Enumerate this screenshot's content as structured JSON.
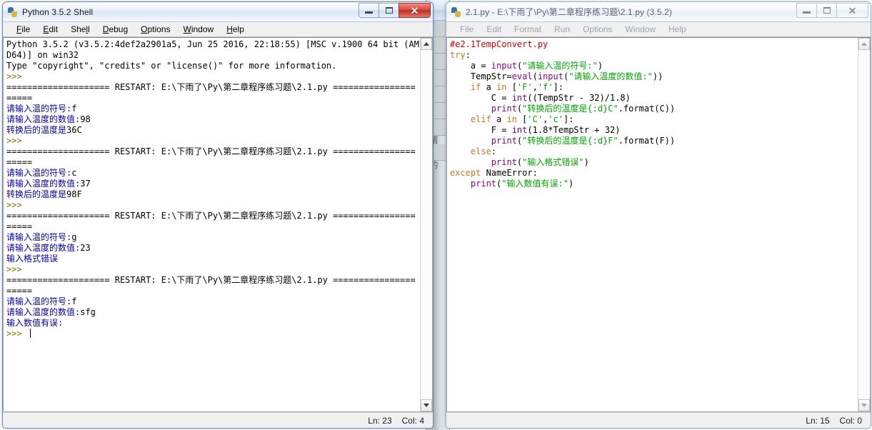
{
  "desktop": {
    "background_color": "#ffffff"
  },
  "background_window": {
    "vertical_text_1": "第",
    "vertical_text_2": "的"
  },
  "shell_window": {
    "title": "Python 3.5.2 Shell",
    "icon": "python-idle-icon",
    "active": true,
    "window_buttons": {
      "minimize": "minimize-button",
      "maximize": "maximize-button",
      "close": "✕"
    },
    "menu": [
      {
        "label": "File",
        "accel": "F"
      },
      {
        "label": "Edit",
        "accel": "E"
      },
      {
        "label": "Shell",
        "accel": "l"
      },
      {
        "label": "Debug",
        "accel": "D"
      },
      {
        "label": "Options",
        "accel": "O"
      },
      {
        "label": "Window",
        "accel": "W"
      },
      {
        "label": "Help",
        "accel": "H"
      }
    ],
    "output_lines": [
      {
        "kind": "normal",
        "text": "Python 3.5.2 (v3.5.2:4def2a2901a5, Jun 25 2016, 22:18:55) [MSC v.1900 64 bit (AMD64)] on win32"
      },
      {
        "kind": "normal",
        "text": "Type \"copyright\", \"credits\" or \"license()\" for more information."
      },
      {
        "kind": "prompt",
        "text": ">>> "
      },
      {
        "kind": "normal",
        "text": "==================== RESTART: E:\\下雨了\\Py\\第二章程序练习题\\2.1.py ====================="
      },
      {
        "kind": "output",
        "text": "请输入温的符号:",
        "input": "f"
      },
      {
        "kind": "output",
        "text": "请输入温度的数值:",
        "input": "98"
      },
      {
        "kind": "output",
        "text": "转换后的温度是",
        "input": "36C"
      },
      {
        "kind": "prompt",
        "text": ">>> "
      },
      {
        "kind": "normal",
        "text": "==================== RESTART: E:\\下雨了\\Py\\第二章程序练习题\\2.1.py ====================="
      },
      {
        "kind": "output",
        "text": "请输入温的符号:",
        "input": "c"
      },
      {
        "kind": "output",
        "text": "请输入温度的数值:",
        "input": "37"
      },
      {
        "kind": "output",
        "text": "转换后的温度是",
        "input": "98F"
      },
      {
        "kind": "prompt",
        "text": ">>> "
      },
      {
        "kind": "normal",
        "text": "==================== RESTART: E:\\下雨了\\Py\\第二章程序练习题\\2.1.py ====================="
      },
      {
        "kind": "output",
        "text": "请输入温的符号:",
        "input": "g"
      },
      {
        "kind": "output",
        "text": "请输入温度的数值:",
        "input": "23"
      },
      {
        "kind": "output",
        "text": "输入格式错误",
        "input": ""
      },
      {
        "kind": "prompt",
        "text": ">>> "
      },
      {
        "kind": "normal",
        "text": "==================== RESTART: E:\\下雨了\\Py\\第二章程序练习题\\2.1.py ====================="
      },
      {
        "kind": "output",
        "text": "请输入温的符号:",
        "input": "f"
      },
      {
        "kind": "output",
        "text": "请输入温度的数值:",
        "input": "sfg"
      },
      {
        "kind": "output",
        "text": "输入数值有误:",
        "input": ""
      },
      {
        "kind": "prompt-caret",
        "text": ">>> "
      }
    ],
    "status": {
      "line_label": "Ln: 23",
      "col_label": "Col: 4"
    }
  },
  "editor_window": {
    "title": "2.1.py - E:\\下雨了\\Py\\第二章程序练习题\\2.1.py (3.5.2)",
    "icon": "python-idle-icon",
    "active": false,
    "window_buttons": {
      "minimize": "minimize-button",
      "maximize": "maximize-button",
      "close": "✕"
    },
    "menu": [
      {
        "label": "File",
        "accel": ""
      },
      {
        "label": "Edit",
        "accel": ""
      },
      {
        "label": "Format",
        "accel": ""
      },
      {
        "label": "Run",
        "accel": ""
      },
      {
        "label": "Options",
        "accel": ""
      },
      {
        "label": "Window",
        "accel": ""
      },
      {
        "label": "Help",
        "accel": ""
      }
    ],
    "code_lines": [
      [
        {
          "t": "#e2.1TempConvert.py",
          "c": "comment"
        }
      ],
      [
        {
          "t": "try",
          "c": "kw"
        },
        {
          "t": ":",
          "c": "norm"
        }
      ],
      [
        {
          "t": "    a = ",
          "c": "norm"
        },
        {
          "t": "input",
          "c": "builtin"
        },
        {
          "t": "(",
          "c": "norm"
        },
        {
          "t": "\"请输入温的符号:\"",
          "c": "str"
        },
        {
          "t": ")",
          "c": "norm"
        }
      ],
      [
        {
          "t": "    TempStr=",
          "c": "norm"
        },
        {
          "t": "eval",
          "c": "builtin"
        },
        {
          "t": "(",
          "c": "norm"
        },
        {
          "t": "input",
          "c": "builtin"
        },
        {
          "t": "(",
          "c": "norm"
        },
        {
          "t": "\"请输入温度的数值:\"",
          "c": "str"
        },
        {
          "t": "))",
          "c": "norm"
        }
      ],
      [
        {
          "t": "    ",
          "c": "norm"
        },
        {
          "t": "if",
          "c": "kw"
        },
        {
          "t": " a ",
          "c": "norm"
        },
        {
          "t": "in",
          "c": "kw"
        },
        {
          "t": " [",
          "c": "norm"
        },
        {
          "t": "'F'",
          "c": "str"
        },
        {
          "t": ",",
          "c": "norm"
        },
        {
          "t": "'f'",
          "c": "str"
        },
        {
          "t": "]:",
          "c": "norm"
        }
      ],
      [
        {
          "t": "        C = ",
          "c": "norm"
        },
        {
          "t": "int",
          "c": "builtin"
        },
        {
          "t": "((TempStr - 32)/1.8)",
          "c": "norm"
        }
      ],
      [
        {
          "t": "        ",
          "c": "norm"
        },
        {
          "t": "print",
          "c": "builtin"
        },
        {
          "t": "(",
          "c": "norm"
        },
        {
          "t": "\"转换后的温度是{:d}C\"",
          "c": "str"
        },
        {
          "t": ".format(C))",
          "c": "norm"
        }
      ],
      [
        {
          "t": "    ",
          "c": "norm"
        },
        {
          "t": "elif",
          "c": "kw"
        },
        {
          "t": " a ",
          "c": "norm"
        },
        {
          "t": "in",
          "c": "kw"
        },
        {
          "t": " [",
          "c": "norm"
        },
        {
          "t": "'C'",
          "c": "str"
        },
        {
          "t": ",",
          "c": "norm"
        },
        {
          "t": "'c'",
          "c": "str"
        },
        {
          "t": "]:",
          "c": "norm"
        }
      ],
      [
        {
          "t": "        F = ",
          "c": "norm"
        },
        {
          "t": "int",
          "c": "builtin"
        },
        {
          "t": "(1.8*TempStr + 32)",
          "c": "norm"
        }
      ],
      [
        {
          "t": "        ",
          "c": "norm"
        },
        {
          "t": "print",
          "c": "builtin"
        },
        {
          "t": "(",
          "c": "norm"
        },
        {
          "t": "\"转换后的温度是{:d}F\"",
          "c": "str"
        },
        {
          "t": ".format(F))",
          "c": "norm"
        }
      ],
      [
        {
          "t": "    ",
          "c": "norm"
        },
        {
          "t": "else",
          "c": "kw"
        },
        {
          "t": ":",
          "c": "norm"
        }
      ],
      [
        {
          "t": "        ",
          "c": "norm"
        },
        {
          "t": "print",
          "c": "builtin"
        },
        {
          "t": "(",
          "c": "norm"
        },
        {
          "t": "\"输入格式错误\"",
          "c": "str"
        },
        {
          "t": ")",
          "c": "norm"
        }
      ],
      [
        {
          "t": "except",
          "c": "kw"
        },
        {
          "t": " NameError:",
          "c": "norm"
        }
      ],
      [
        {
          "t": "    ",
          "c": "norm"
        },
        {
          "t": "print",
          "c": "builtin"
        },
        {
          "t": "(",
          "c": "norm"
        },
        {
          "t": "\"输入数值有误:\"",
          "c": "str"
        },
        {
          "t": ")",
          "c": "norm"
        }
      ]
    ],
    "status": {
      "line_label": "Ln: 15",
      "col_label": "Col: 0"
    }
  },
  "colors": {
    "comment": "#dd0000",
    "keyword": "#cc7722",
    "string": "#00aa00",
    "builtin": "#900090",
    "shell_output": "#0000bb",
    "shell_prompt": "#8a6d00",
    "close_button": "#cc3322"
  }
}
